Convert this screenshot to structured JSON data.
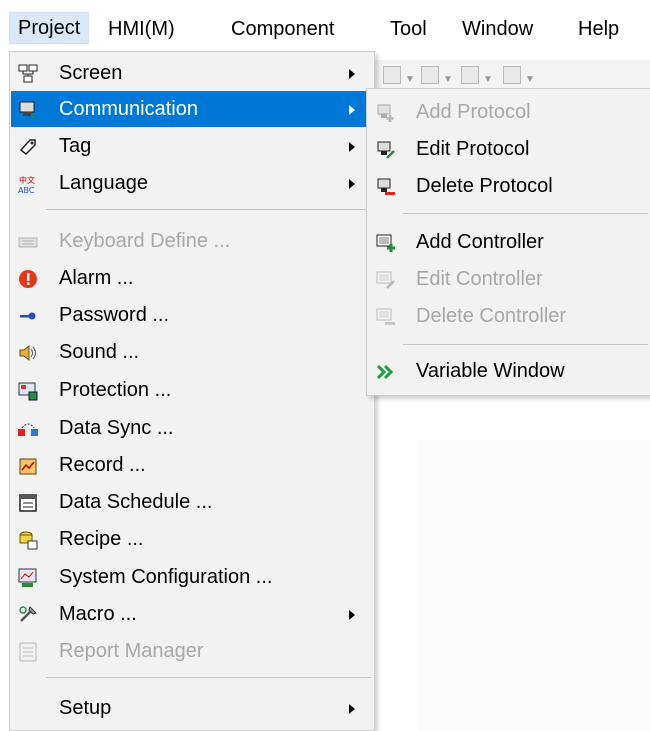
{
  "menubar": {
    "items": [
      {
        "label": "Project"
      },
      {
        "label": "HMI(M)"
      },
      {
        "label": "Component"
      },
      {
        "label": "Tool"
      },
      {
        "label": "Window"
      },
      {
        "label": "Help"
      }
    ]
  },
  "project_menu": {
    "items": [
      {
        "label": "Screen",
        "icon": "screen-icon"
      },
      {
        "label": "Communication",
        "icon": "communication-icon"
      },
      {
        "label": "Tag",
        "icon": "tag-icon"
      },
      {
        "label": "Language",
        "icon": "language-icon"
      },
      {
        "label": "Keyboard Define ...",
        "icon": "keyboard-icon"
      },
      {
        "label": "Alarm ...",
        "icon": "alarm-icon"
      },
      {
        "label": "Password ...",
        "icon": "key-icon"
      },
      {
        "label": "Sound ...",
        "icon": "sound-icon"
      },
      {
        "label": "Protection ...",
        "icon": "protection-icon"
      },
      {
        "label": "Data Sync ...",
        "icon": "data-sync-icon"
      },
      {
        "label": "Record ...",
        "icon": "record-icon"
      },
      {
        "label": "Data Schedule ...",
        "icon": "data-schedule-icon"
      },
      {
        "label": "Recipe ...",
        "icon": "recipe-icon"
      },
      {
        "label": "System Configuration ...",
        "icon": "system-configuration-icon"
      },
      {
        "label": "Macro ...",
        "icon": "macro-icon"
      },
      {
        "label": "Report Manager",
        "icon": "report-manager-icon"
      },
      {
        "label": "Setup",
        "icon": ""
      }
    ]
  },
  "communication_menu": {
    "items": [
      {
        "label": "Add Protocol",
        "icon": "add-protocol-icon"
      },
      {
        "label": "Edit Protocol",
        "icon": "edit-protocol-icon"
      },
      {
        "label": "Delete Protocol",
        "icon": "delete-protocol-icon"
      },
      {
        "label": "Add Controller",
        "icon": "add-controller-icon"
      },
      {
        "label": "Edit Controller",
        "icon": "edit-controller-icon"
      },
      {
        "label": "Delete Controller",
        "icon": "delete-controller-icon"
      },
      {
        "label": "Variable Window",
        "icon": "double-chevron-icon"
      }
    ]
  },
  "colors": {
    "selection": "#0078d7",
    "menu_background": "#f2f2f2",
    "disabled_text": "#a8a8a8"
  }
}
